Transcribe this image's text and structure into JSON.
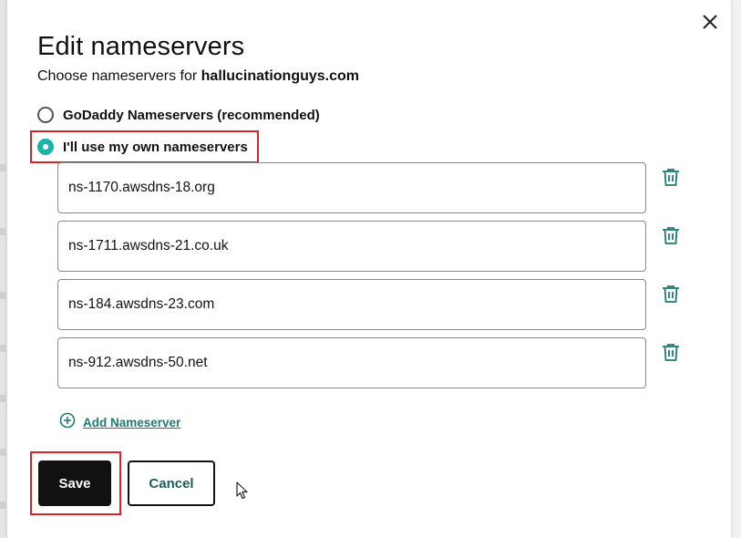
{
  "modal": {
    "title": "Edit nameservers",
    "subtitle_prefix": "Choose nameservers for ",
    "domain": "hallucinationguys.com",
    "close_icon": "close-icon"
  },
  "options": {
    "godaddy": {
      "label": "GoDaddy Nameservers (recommended)",
      "checked": false
    },
    "custom": {
      "label": "I'll use my own nameservers",
      "checked": true
    }
  },
  "nameservers": [
    "ns-1170.awsdns-18.org",
    "ns-1711.awsdns-21.co.uk",
    "ns-184.awsdns-23.com",
    "ns-912.awsdns-50.net"
  ],
  "add_nameserver_label": "Add Nameserver",
  "buttons": {
    "save": "Save",
    "cancel": "Cancel"
  },
  "colors": {
    "accent": "#1bb3a6",
    "link": "#1f7a73",
    "highlight": "#d8232a",
    "primary_button": "#111111"
  },
  "icons": {
    "delete": "trash-icon",
    "add": "plus-circle-icon"
  }
}
